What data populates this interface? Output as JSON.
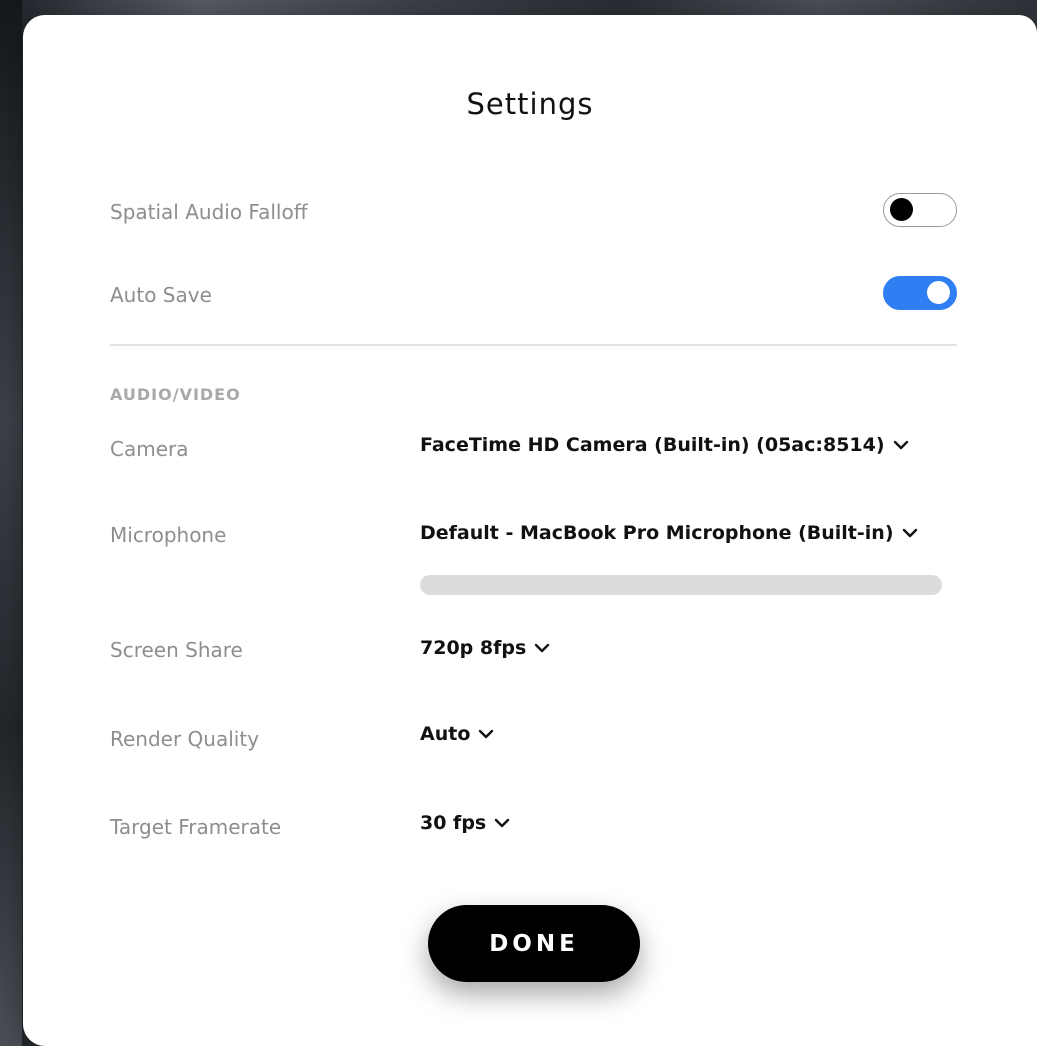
{
  "modal": {
    "title": "Settings",
    "done_label": "DONE"
  },
  "toggles": {
    "spatial_audio_falloff": {
      "label": "Spatial Audio Falloff",
      "on": false
    },
    "auto_save": {
      "label": "Auto Save",
      "on": true
    }
  },
  "audio_video": {
    "section_label": "AUDIO/VIDEO",
    "camera": {
      "label": "Camera",
      "value": "FaceTime HD Camera (Built-in) (05ac:8514)"
    },
    "microphone": {
      "label": "Microphone",
      "value": "Default - MacBook Pro Microphone (Built-in)",
      "level": 0
    },
    "screen_share": {
      "label": "Screen Share",
      "value": "720p 8fps"
    },
    "render_quality": {
      "label": "Render Quality",
      "value": "Auto"
    },
    "target_framerate": {
      "label": "Target Framerate",
      "value": "30 fps"
    }
  },
  "icons": {
    "dropdown": "chevron-down-icon"
  },
  "colors": {
    "toggle_on": "#2f7ef2",
    "toggle_off_knob": "#000000",
    "meter_track": "#dcdcdc",
    "label_text": "#8e8e8e",
    "value_text": "#111111",
    "done_background": "#000000"
  }
}
